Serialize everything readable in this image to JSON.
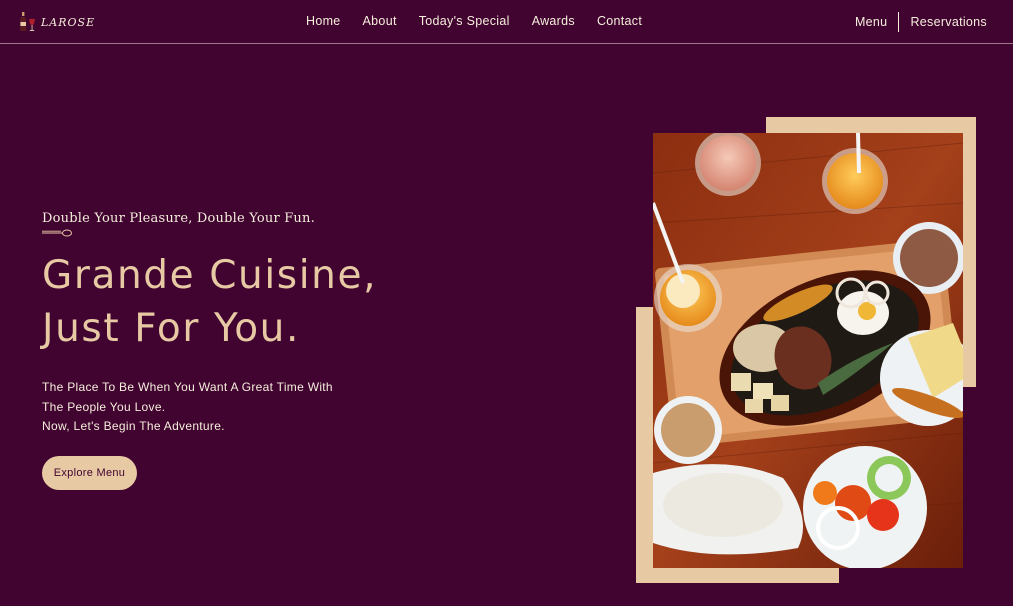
{
  "nav": {
    "logo_text": "LAROSE",
    "logo_icon": "wine-bottle-glass-icon",
    "links": [
      "Home",
      "About",
      "Today's Special",
      "Awards",
      "Contact"
    ],
    "right": {
      "menu": "Menu",
      "reservations": "Reservations"
    }
  },
  "hero": {
    "subtitle": "Double Your Pleasure, Double Your Fun.",
    "subtitle_icon": "spoon-icon",
    "headline_line1": "Grande Cuisine,",
    "headline_line2": "Just For You.",
    "desc_line1": "The Place To Be When You Want A Great Time With",
    "desc_line2": "The People You Love.",
    "desc_line3": "Now, Let's Begin The Adventure.",
    "cta": "Explore Menu"
  },
  "colors": {
    "background": "#410330",
    "accent": "#E7C9A4",
    "text": "#F5EFDB"
  }
}
